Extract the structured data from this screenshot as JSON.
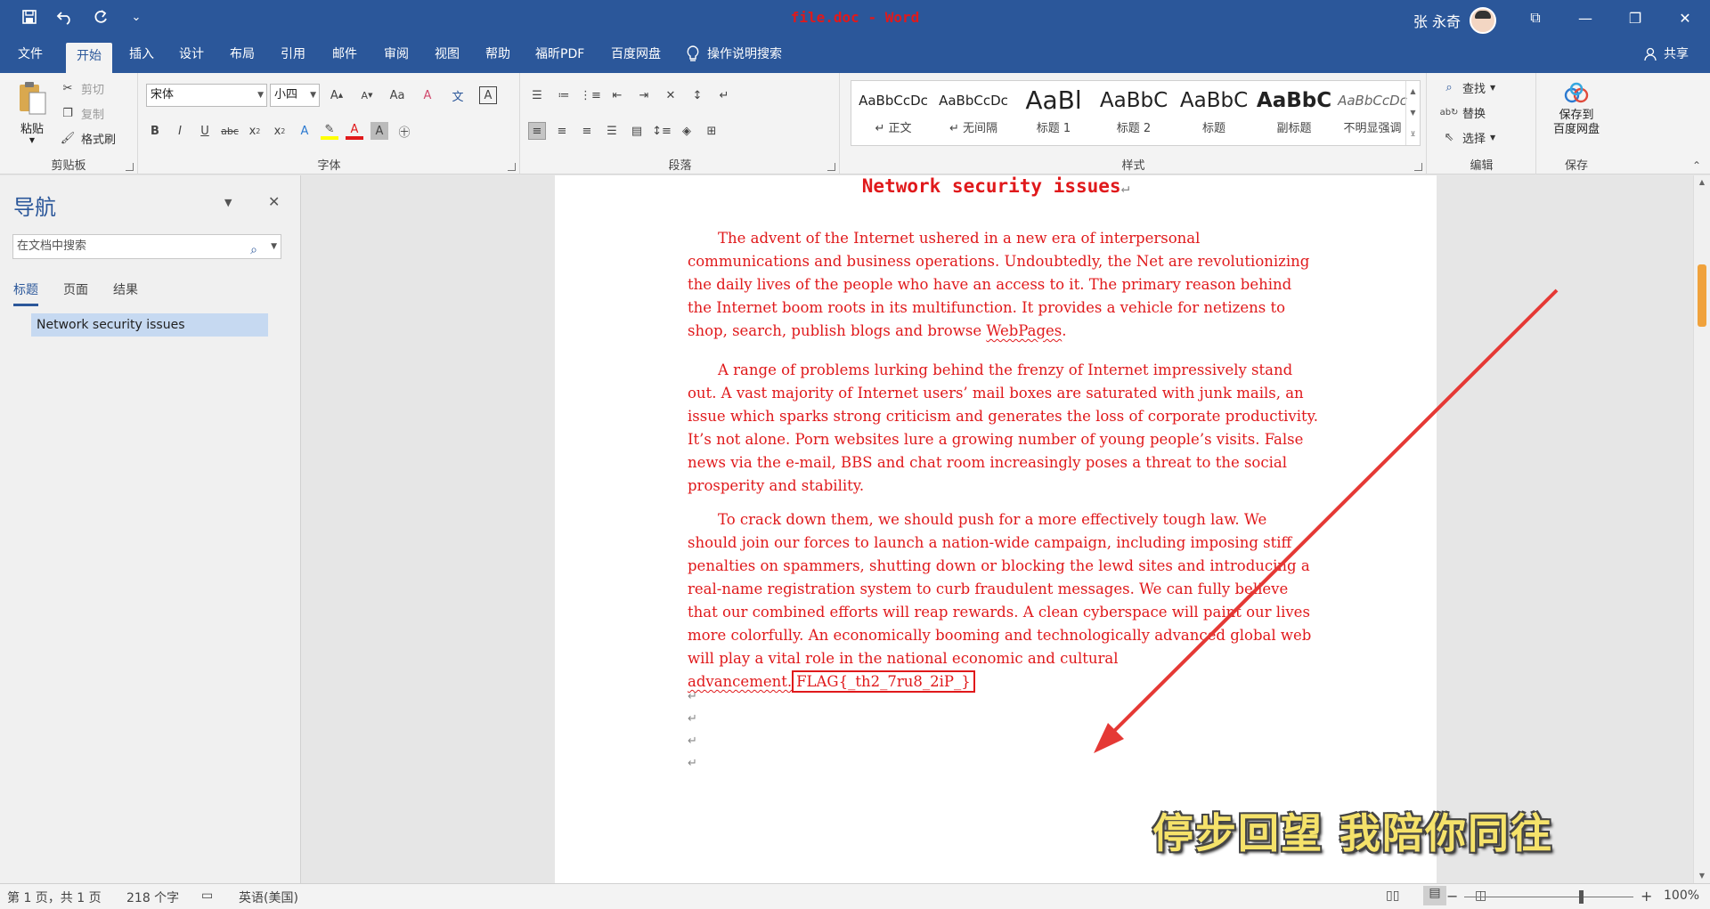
{
  "title_bar": {
    "doc_title": "file.doc  -  Word",
    "user_name": "张 永奇",
    "window_controls": [
      "⧉",
      "—",
      "❐",
      "✕"
    ]
  },
  "quick_access": {
    "customize_label": "⌄"
  },
  "tabs": [
    "文件",
    "开始",
    "插入",
    "设计",
    "布局",
    "引用",
    "邮件",
    "审阅",
    "视图",
    "帮助",
    "福昕PDF",
    "百度网盘"
  ],
  "active_tab": "开始",
  "tell_me": "操作说明搜索",
  "share": "共享",
  "clipboard": {
    "label": "剪贴板",
    "paste": "粘贴",
    "cut": "剪切",
    "copy": "复制",
    "format_painter": "格式刷"
  },
  "font": {
    "label": "字体",
    "name": "宋体",
    "size": "小四"
  },
  "paragraph": {
    "label": "段落"
  },
  "styles": {
    "label": "样式",
    "items": [
      {
        "sample": "AaBbCcDc",
        "name": "↵ 正文"
      },
      {
        "sample": "AaBbCcDc",
        "name": "↵ 无间隔"
      },
      {
        "sample": "AaBl",
        "name": "标题 1"
      },
      {
        "sample": "AaBbC",
        "name": "标题 2"
      },
      {
        "sample": "AaBbC",
        "name": "标题"
      },
      {
        "sample": "AaBbC",
        "name": "副标题"
      },
      {
        "sample": "AaBbCcDc",
        "name": "不明显强调"
      }
    ]
  },
  "editing": {
    "label": "编辑",
    "find": "查找",
    "replace": "替换",
    "select": "选择"
  },
  "save_group": {
    "label": "保存",
    "button_line1": "保存到",
    "button_line2": "百度网盘"
  },
  "nav_pane": {
    "title": "导航",
    "search_placeholder": "在文档中搜索",
    "tabs": [
      "标题",
      "页面",
      "结果"
    ],
    "active_tab": "标题",
    "heading": "Network security issues"
  },
  "document": {
    "title": "Network security issues",
    "paragraph1": "The advent of the Internet ushered in a new era of interpersonal communications and business operations. Undoubtedly, the Net are revolutionizing the daily lives of the people who have an access to it. The primary reason behind the Internet boom roots in its multifunction. It provides a vehicle for netizens to shop, search, publish blogs and browse ",
    "paragraph1_squiggle": "WebPages",
    "paragraph1_end": ".",
    "paragraph2": "A range of problems lurking behind the frenzy of Internet impressively stand out. A vast majority of Internet users’ mail boxes are saturated with junk mails, an issue which sparks strong criticism and generates the loss of corporate productivity. It’s not alone. Porn websites lure a growing number of young people’s visits. False news via the e-mail, BBS and chat room increasingly poses a threat to the social prosperity and stability.",
    "paragraph3": "To crack down them, we should push for a more effectively tough law. We should join our forces to launch a nation-wide campaign, including imposing stiff penalties on spammers, shutting down or blocking the lewd sites and introducing a real-name registration system to curb fraudulent messages. We can fully believe that our combined efforts will reap rewards. A clean cyberspace will paint our lives more colorfully. An economically booming and technologically advanced global web will play a vital role in the national economic and cultural ",
    "paragraph3_squiggle": "advancement.",
    "flag": "FLAG{_th2_7ru8_2iP_}",
    "paragraph_mark": "↵"
  },
  "overlay_caption": "停步回望 我陪你同往",
  "status_bar": {
    "page": "第 1 页，共 1 页",
    "words": "218 个字",
    "language": "英语(美国)",
    "zoom": "100%"
  },
  "colors": {
    "brand": "#2b579a",
    "doc_text": "#e0191b",
    "caption": "#f5e26a",
    "highlight": "#c6d9f1"
  },
  "icons": [
    "save-icon",
    "undo-icon",
    "redo-icon",
    "paste-icon",
    "scissors-icon",
    "copy-icon",
    "brush-icon",
    "search-icon",
    "close-icon",
    "lightbulb-icon",
    "person-icon",
    "cloud-save-icon"
  ]
}
